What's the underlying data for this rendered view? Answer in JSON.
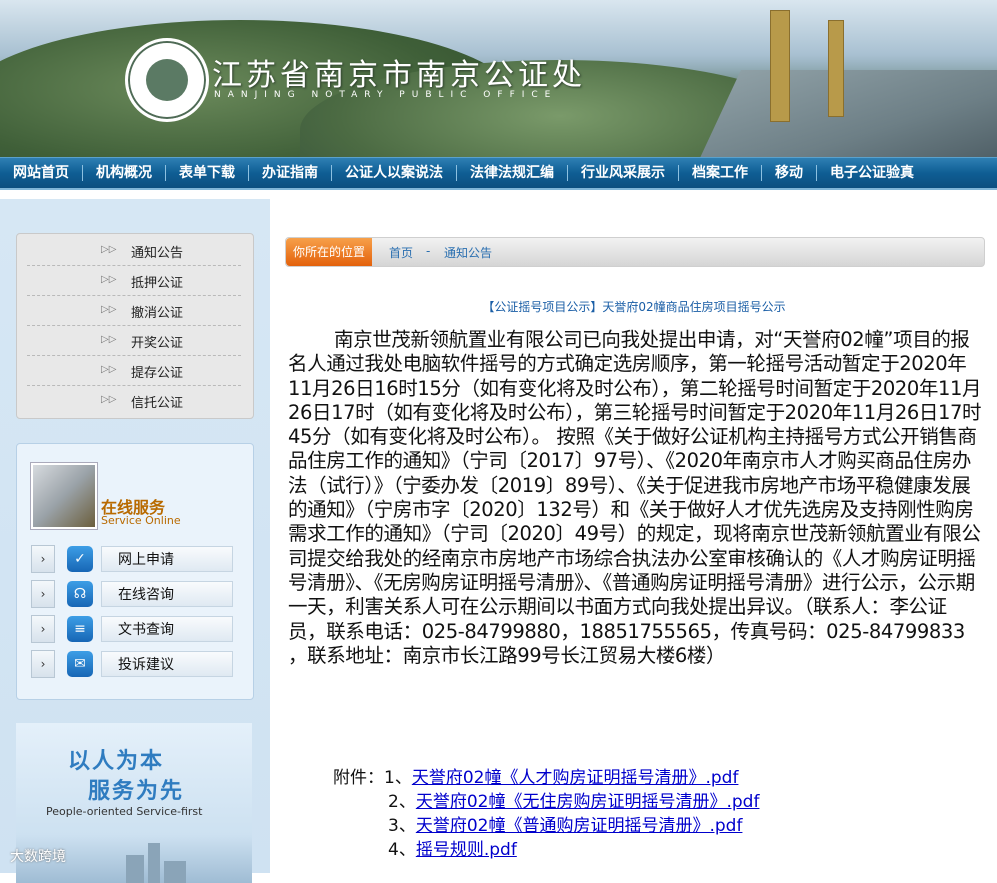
{
  "header": {
    "site_title": "江苏省南京市南京公证处",
    "site_subtitle": "NANJING NOTARY PUBLIC OFFICE",
    "logo_text": "NANJING NOTARY PUBLIC OFFICE"
  },
  "nav": [
    "网站首页",
    "机构概况",
    "表单下载",
    "办证指南",
    "公证人以案说法",
    "法律法规汇编",
    "行业风采展示",
    "档案工作",
    "移动",
    "电子公证验真"
  ],
  "sidebar": {
    "menu": [
      "通知公告",
      "抵押公证",
      "撤消公证",
      "开奖公证",
      "提存公证",
      "信托公证"
    ],
    "online": {
      "title": "在线服务",
      "subtitle": "Service Online",
      "items": [
        "网上申请",
        "在线咨询",
        "文书查询",
        "投诉建议"
      ]
    },
    "slogan": {
      "line1": "以人为本",
      "line2": "服务为先",
      "line3": "People-oriented  Service-first"
    }
  },
  "breadcrumb": {
    "label": "你所在的位置",
    "home": "首页",
    "sep": "-",
    "current": "通知公告"
  },
  "article": {
    "title": "【公证摇号项目公示】天誉府02幢商品住房项目摇号公示",
    "body": "南京世茂新领航置业有限公司已向我处提出申请，对“天誉府02幢”项目的报名人通过我处电脑软件摇号的方式确定选房顺序，第一轮摇号活动暂定于2020年11月26日16时15分（如有变化将及时公布），第二轮摇号时间暂定于2020年11月26日17时（如有变化将及时公布），第三轮摇号时间暂定于2020年11月26日17时45分（如有变化将及时公布）。 按照《关于做好公证机构主持摇号方式公开销售商品住房工作的通知》（宁司〔2017〕97号）、《2020年南京市人才购买商品住房办法（试行）》（宁委办发〔2019〕89号）、《关于促进我市房地产市场平稳健康发展的通知》（宁房市字〔2020〕132号）和《关于做好人才优先选房及支持刚性购房需求工作的通知》（宁司〔2020〕49号）的规定，现将南京世茂新领航置业有限公司提交给我处的经南京市房地产市场综合执法办公室审核确认的《人才购房证明摇号清册》、《无房购房证明摇号清册》、《普通购房证明摇号清册》进行公示，公示期一天，利害关系人可在公示期间以书面方式向我处提出异议。（联系人：李公证员，联系电话：025-84799880，18851755565，传真号码：025-84799833 ，联系地址：南京市长江路99号长江贸易大楼6楼）",
    "attachments_label": "附件：",
    "attachments": [
      {
        "num": "1、",
        "link": "天誉府02幢《人才购房证明摇号清册》.pdf"
      },
      {
        "num": "2、",
        "link": "天誉府02幢《无住房购房证明摇号清册》.pdf"
      },
      {
        "num": "3、",
        "link": "天誉府02幢《普通购房证明摇号清册》.pdf"
      },
      {
        "num": "4、",
        "link": "摇号规则.pdf"
      }
    ]
  },
  "watermark": "大数跨境",
  "colors": {
    "nav_bg": "#0f5e94",
    "accent_orange": "#e3610b",
    "link_blue": "#0000cc",
    "service_orange": "#b86a00",
    "slogan_blue": "#2f7cc0"
  },
  "icons": [
    "double-chevron-right-icon",
    "chevron-right-icon",
    "checklist-icon",
    "headset-icon",
    "document-list-icon",
    "chat-bubble-icon"
  ]
}
